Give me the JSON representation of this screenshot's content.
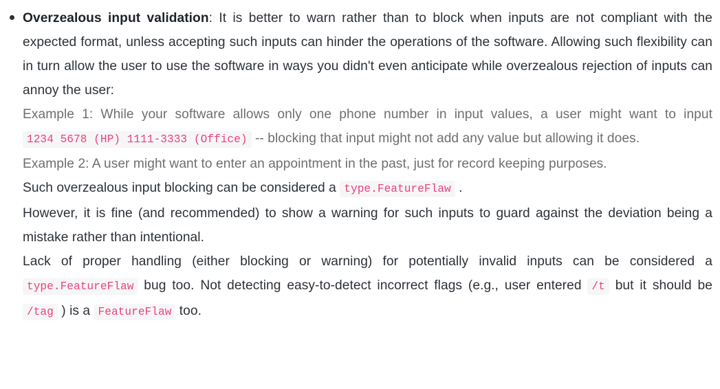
{
  "document": {
    "bullet_glyph": "•",
    "colors": {
      "text": "#2c3138",
      "muted_text": "#6e6e73",
      "code_text": "#e8437f",
      "code_background": "#f6f6f7",
      "page_background": "#ffffff",
      "bold_term": "#1f2328"
    },
    "blocks": {
      "lead_term": "Overzealous input validation",
      "lead_body": ": It is better to warn rather than to block when inputs are not compliant with the expected format, unless accepting such inputs can hinder the operations of the software. Allowing such flexibility can in turn allow the user to use the software in ways you didn't even anticipate while overzealous rejection of inputs can annoy the user:",
      "example1_before": "Example 1: While your software allows only one phone number in input values, a user might want to input",
      "example1_code": "1234 5678 (HP) 1111-3333 (Office)",
      "example1_after": "-- blocking that input might not add any value but allowing it does.",
      "example2": "Example 2: A user might want to enter an appointment in the past, just for record keeping purposes.",
      "such_before": "Such overzealous input blocking can be considered a",
      "such_code": "type.FeatureFlaw",
      "such_after": ".",
      "however": "However, it is fine (and recommended) to show a warning for such inputs to guard against the deviation being a mistake rather than intentional.",
      "lack_before": "Lack of proper handling (either blocking or warning) for potentially invalid inputs can be considered a",
      "lack_code1": "type.FeatureFlaw",
      "lack_mid1": "bug too. Not detecting easy-to-detect incorrect flags (e.g., user entered",
      "lack_code2": "/t",
      "lack_mid2": "but it should be",
      "lack_code3": "/tag",
      "lack_mid3": ") is a",
      "lack_code4": "FeatureFlaw",
      "lack_after": "too."
    }
  }
}
